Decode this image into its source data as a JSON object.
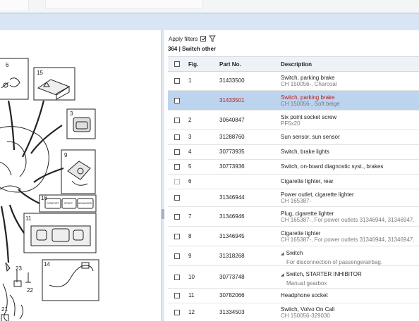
{
  "toolbar": {
    "filters_label": "Apply filters"
  },
  "section": {
    "title": "364  |  Switch other"
  },
  "table": {
    "headers": {
      "fig": "Fig.",
      "part_no": "Part No.",
      "description": "Description"
    },
    "rows": [
      {
        "fig": "1",
        "part_no": "31433500",
        "desc": "Switch, parking brake",
        "sub": "CH 150056-, Charcoal",
        "selected": false
      },
      {
        "fig": "",
        "part_no": "31433501",
        "desc": "Switch, parking brake",
        "sub": "CH 150056-, Soft beige",
        "selected": true
      },
      {
        "fig": "2",
        "part_no": "30640847",
        "desc": "Six point socket screw",
        "sub": "PF5x20",
        "selected": false
      },
      {
        "fig": "3",
        "part_no": "31288760",
        "desc": "Sun sensor, sun sensor",
        "sub": "",
        "selected": false
      },
      {
        "fig": "4",
        "part_no": "30773935",
        "desc": "Switch, brake lights",
        "sub": "",
        "selected": false
      },
      {
        "fig": "5",
        "part_no": "30773936",
        "desc": "Switch, on-board diagnostic syst., brakes",
        "sub": "",
        "selected": false
      },
      {
        "fig": "6",
        "part_no": "",
        "desc": "Cigarette lighter, rear",
        "sub": "",
        "selected": false,
        "disabled": true
      },
      {
        "fig": "",
        "part_no": "31346944",
        "desc": "Power outlet, cigarette lighter",
        "sub": "CH 165387-",
        "selected": false
      },
      {
        "fig": "7",
        "part_no": "31346946",
        "desc": "Plug, cigarette lighter",
        "sub": "CH 165387-, For power outlets 31346944, 31346947.",
        "selected": false
      },
      {
        "fig": "8",
        "part_no": "31346945",
        "desc": "Cigarette lighter",
        "sub": "CH 165387-, For power outlets 31346944, 31346947.",
        "selected": false
      },
      {
        "fig": "9",
        "part_no": "31318268",
        "desc": "Switch",
        "sub": "For disconnection of passengerairbag.",
        "selected": false,
        "expandable": true
      },
      {
        "fig": "10",
        "part_no": "30773748",
        "desc": "Switch, STARTER INHIBITOR",
        "sub": "Manual gearbox",
        "selected": false,
        "expandable": true
      },
      {
        "fig": "11",
        "part_no": "30782066",
        "desc": "Headphone socket",
        "sub": "",
        "selected": false
      },
      {
        "fig": "12",
        "part_no": "31334503",
        "desc": "Switch, Volvo On Call",
        "sub": "CH 150056-329030",
        "selected": false
      }
    ]
  },
  "diagram": {
    "callouts": [
      "6",
      "15",
      "3",
      "9",
      "16",
      "11",
      "23",
      "22",
      "14",
      "21"
    ],
    "button_labels": [
      "COMFORT",
      "SPORT",
      "ADVANCED"
    ]
  }
}
